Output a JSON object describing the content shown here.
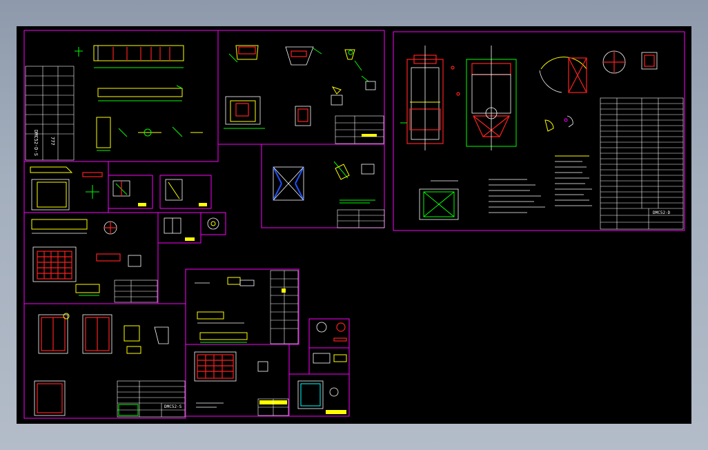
{
  "drawing": {
    "sheet_labels": {
      "main_title_block": "DMC52-D",
      "bottom_title_block": "DMC52-S",
      "vertical_label": "DMC52-D-S",
      "code_rotated": "777"
    }
  },
  "colors": {
    "background": "#000000",
    "sheet_border": "#ff00ff",
    "geometry_primary": "#ffff00",
    "geometry_secondary": "#00ff00",
    "hidden_lines": "#ff2020",
    "dimensions": "#ffffff",
    "accent_blue": "#2050ff",
    "app_gradient_top": "#8e9aab"
  }
}
